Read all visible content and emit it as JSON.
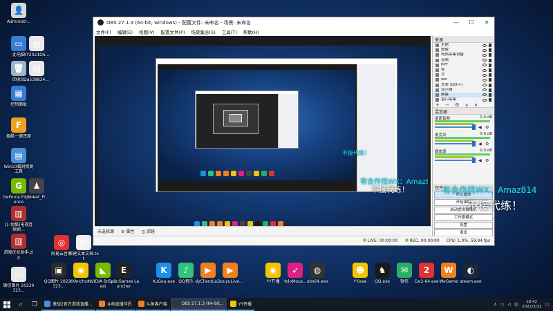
{
  "desktop": {
    "icons_left": [
      {
        "label": "Administr...",
        "color": "#d8d8d8",
        "glyph": "👤"
      },
      {
        "label": "此电脑",
        "color": "#3a7bd5",
        "glyph": "▭"
      },
      {
        "label": "YY2021O6...",
        "color": "#e8e8e8",
        "glyph": "▤"
      },
      {
        "label": "回收站",
        "color": "#9fb4c8",
        "glyph": "🗑"
      },
      {
        "label": "3a538834...",
        "color": "#e8e8e8",
        "glyph": "▤"
      },
      {
        "label": "控制面板",
        "color": "#3a7bd5",
        "glyph": "▦"
      },
      {
        "label": "极酷一键还原",
        "color": "#f0a020",
        "glyph": "F"
      },
      {
        "label": "Win10漏洞修复工具",
        "color": "#4a90d9",
        "glyph": "▤"
      },
      {
        "label": "GeForce Experience",
        "color": "#76b900",
        "glyph": "G"
      },
      {
        "label": "1Street_Fi...",
        "color": "#444",
        "glyph": "♟"
      },
      {
        "label": "[1-优酷]电视连续剧...",
        "color": "#b03030",
        "glyph": "▥"
      },
      {
        "label": "游戏优化助手.zip",
        "color": "#b03030",
        "glyph": "▥"
      },
      {
        "label": "微信图片 20220323...",
        "color": "#e8e8e8",
        "glyph": "▭"
      },
      {
        "label": "网易云音乐",
        "color": "#d33",
        "glyph": "◎"
      },
      {
        "label": "新建文本文档.txt",
        "color": "#f0f0f0",
        "glyph": "▤"
      }
    ],
    "icons_bottom": [
      {
        "label": "QQ图片 20220323...",
        "color": "#2a2a2a",
        "glyph": "▣"
      },
      {
        "label": "YYAnchor...",
        "color": "#f4c400",
        "glyph": "◉"
      },
      {
        "label": "NVIDIA Broadcast",
        "color": "#76b900",
        "glyph": "◣"
      },
      {
        "label": "Epic Games Launcher",
        "color": "#222",
        "glyph": "E"
      },
      {
        "label": "KuGou.exe",
        "color": "#1e8ee8",
        "glyph": "K"
      },
      {
        "label": "QQ音乐",
        "color": "#31c27c",
        "glyph": "♪"
      },
      {
        "label": "dyClientLa...",
        "color": "#f08020",
        "glyph": "▶"
      },
      {
        "label": "DouyuLive...",
        "color": "#f08020",
        "glyph": "▶"
      },
      {
        "label": "YY开播",
        "color": "#f4c400",
        "glyph": "◉"
      },
      {
        "label": "YoloMous...",
        "color": "#e02080",
        "glyph": "➶"
      },
      {
        "label": "obs64.exe",
        "color": "#333",
        "glyph": "◍"
      },
      {
        "label": "YY.exe",
        "color": "#f4c400",
        "glyph": "☻"
      },
      {
        "label": "QQ.exe",
        "color": "#1a1a1a",
        "glyph": "♞"
      },
      {
        "label": "微信",
        "color": "#2aae67",
        "glyph": "✉"
      },
      {
        "label": "Cw2-64.exe",
        "color": "#d33",
        "glyph": "2"
      },
      {
        "label": "WeGame",
        "color": "#f08020",
        "glyph": "W"
      },
      {
        "label": "steam.exe",
        "color": "#1b2838",
        "glyph": "◐"
      }
    ]
  },
  "obs": {
    "title": "OBS 27.1.3 (64-bit, windows) - 配置文件: 未命名 - 场景: 未命名",
    "menu": [
      "文件(F)",
      "编辑(E)",
      "视图(V)",
      "配置文件(P)",
      "场景集合(S)",
      "工具(T)",
      "帮助(H)"
    ],
    "window_controls": {
      "minimize": "—",
      "maximize": "☐",
      "close": "✕"
    },
    "preview_status": {
      "left": "未选择源",
      "properties": "属性",
      "filters": "滤镜"
    },
    "sources_header": "来源",
    "sources": [
      "主题",
      "图像",
      "视频采集设备",
      "音频",
      "PPT",
      "视",
      "文",
      "win",
      "文本 (GDI+)",
      "显示器",
      "屏幕",
      "窗口采集"
    ],
    "sources_toolbar": "+ − ⚙ ∧ ∨",
    "mixer_header": "混音器",
    "mixer": [
      {
        "name": "桌面音频",
        "db": "0.0 dB"
      },
      {
        "name": "麦克风",
        "db": "0.0 dB"
      },
      {
        "name": "媒体源",
        "db": "0.0 dB"
      }
    ],
    "controls_header": "控件",
    "controls": [
      "停止播放",
      "开始录制",
      "启动虚拟摄像机",
      "工作室模式",
      "设置",
      "退出"
    ],
    "status": {
      "live": "LIVE: 00:00:00",
      "rec": "REC: 00:00:00",
      "cpu": "CPU: 1.0%, 59.94 fps"
    }
  },
  "watermark": {
    "line1": "不接代练！",
    "line2": "有合作找WX：Amaz814",
    "line3": "不接代练！"
  },
  "taskbar": {
    "search_icon": "search-icon",
    "apps": [
      {
        "label": "激战2官方游戏直播...",
        "color": "#4a8ee0"
      },
      {
        "label": "斗鱼直播伴侣",
        "color": "#f08020"
      },
      {
        "label": "斗鱼客户端",
        "color": "#f08020"
      },
      {
        "label": "OBS 27.1.3 (64-bit...",
        "color": "#333"
      },
      {
        "label": "YY开播",
        "color": "#f4c400"
      }
    ],
    "clock_time": "18:42",
    "clock_date": "2022/3/31",
    "lang": "中"
  }
}
